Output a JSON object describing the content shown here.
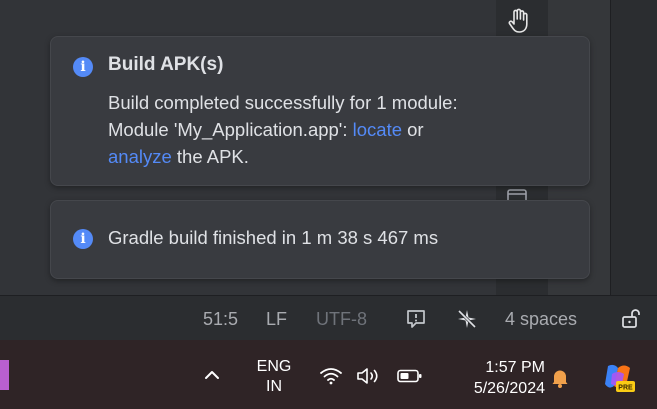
{
  "notifications": [
    {
      "icon": "info-icon",
      "title": "Build APK(s)",
      "line1": "Build completed successfully for 1 module:",
      "line2_prefix": "Module 'My_Application.app': ",
      "link_locate": "locate",
      "line2_suffix": " or",
      "link_analyze": "analyze",
      "line3_suffix": " the APK."
    },
    {
      "icon": "info-icon",
      "text": "Gradle build finished in 1 m 38 s 467 ms"
    }
  ],
  "status_bar": {
    "position": "51:5",
    "line_separator": "LF",
    "encoding": "UTF-8",
    "indent": "4 spaces"
  },
  "taskbar": {
    "lang_line1": "ENG",
    "lang_line2": "IN",
    "time": "1:57 PM",
    "date": "5/26/2024"
  },
  "colors": {
    "link": "#548af7",
    "info_icon": "#548af7",
    "notification_bell": "#f0a04b"
  }
}
